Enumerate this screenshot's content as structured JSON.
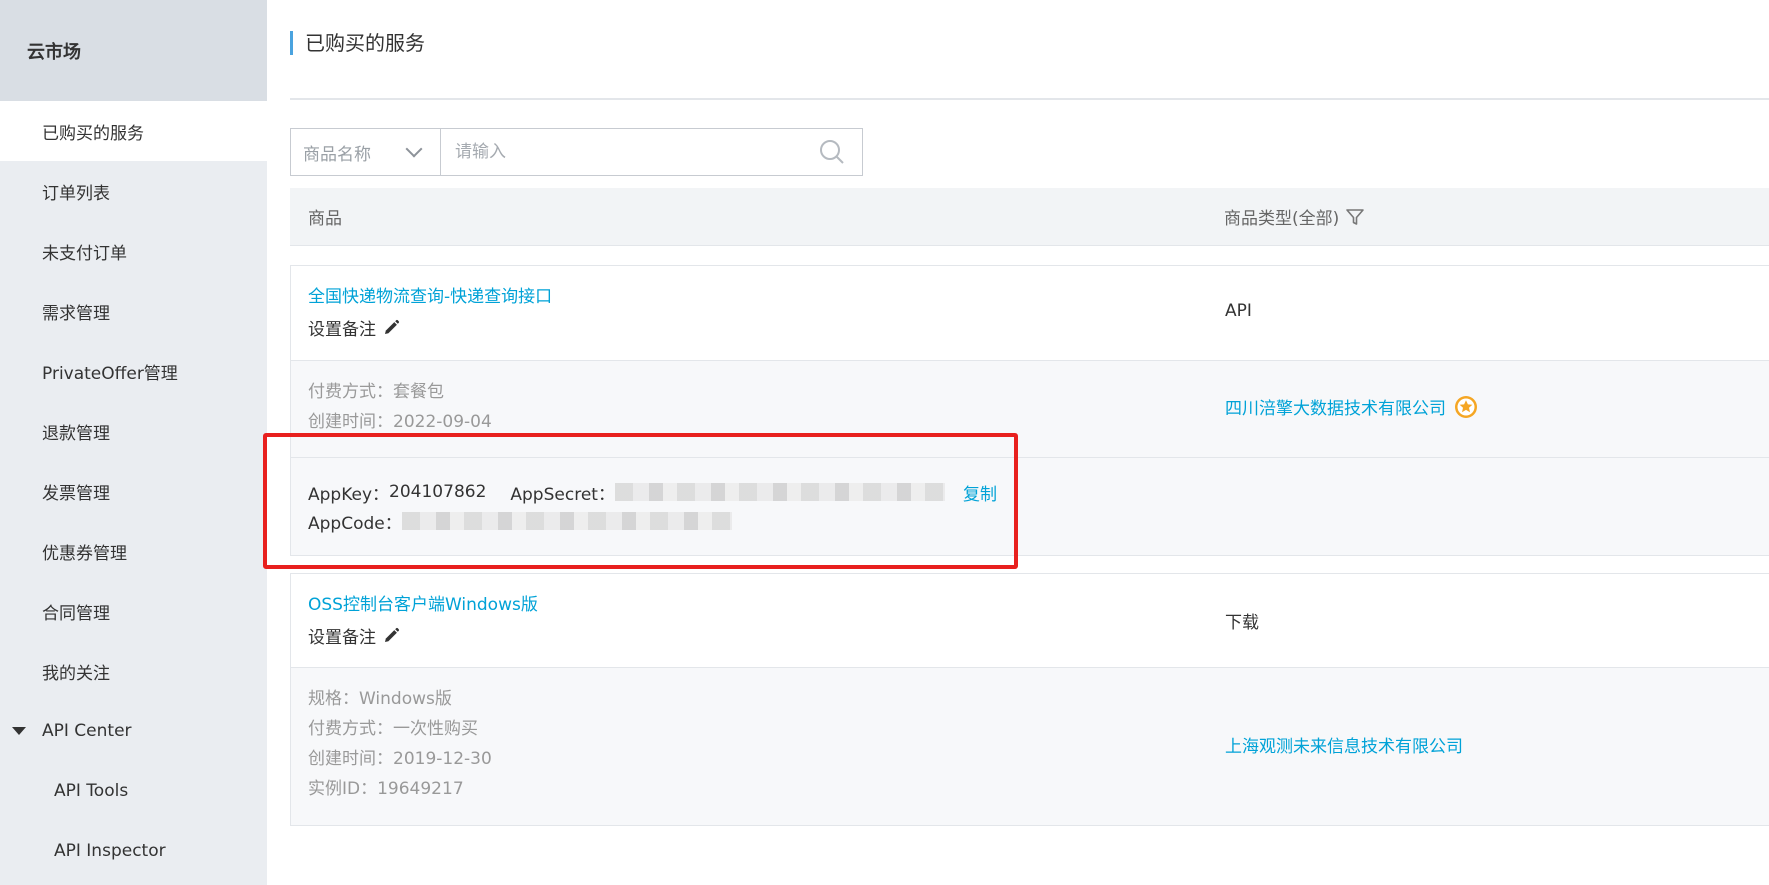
{
  "sidebar": {
    "title": "云市场",
    "items": [
      {
        "label": "已购买的服务"
      },
      {
        "label": "订单列表"
      },
      {
        "label": "未支付订单"
      },
      {
        "label": "需求管理"
      },
      {
        "label": "PrivateOffer管理"
      },
      {
        "label": "退款管理"
      },
      {
        "label": "发票管理"
      },
      {
        "label": "优惠券管理"
      },
      {
        "label": "合同管理"
      },
      {
        "label": "我的关注"
      }
    ],
    "group": {
      "label": "API Center",
      "children": [
        {
          "label": "API Tools"
        },
        {
          "label": "API Inspector"
        }
      ]
    }
  },
  "page": {
    "title": "已购买的服务"
  },
  "search": {
    "select_label": "商品名称",
    "placeholder": "请输入"
  },
  "table": {
    "col_product": "商品",
    "col_type": "商品类型(全部)"
  },
  "services": [
    {
      "name": "全国快递物流查询-快递查询接口",
      "remark_label": "设置备注",
      "type": "API",
      "pay_method": "付费方式：套餐包",
      "created": "创建时间：2022-09-04",
      "vendor": "四川涪擎大数据技术有限公司",
      "appkey_label": "AppKey：",
      "appkey_value": "204107862",
      "appsecret_label": "AppSecret：",
      "appcode_label": "AppCode：",
      "copy_label": "复制"
    },
    {
      "name": "OSS控制台客户端Windows版",
      "remark_label": "设置备注",
      "type": "下载",
      "spec": "规格：Windows版",
      "pay_method": "付费方式：一次性购买",
      "created": "创建时间：2019-12-30",
      "instance_id": "实例ID：19649217",
      "vendor": "上海观测未来信息技术有限公司"
    }
  ],
  "colors": {
    "accent": "#00a2d7",
    "highlight": "#e8201e",
    "sidebar_bg": "#eaedf1",
    "sidebar_header_bg": "#d9dee4"
  }
}
